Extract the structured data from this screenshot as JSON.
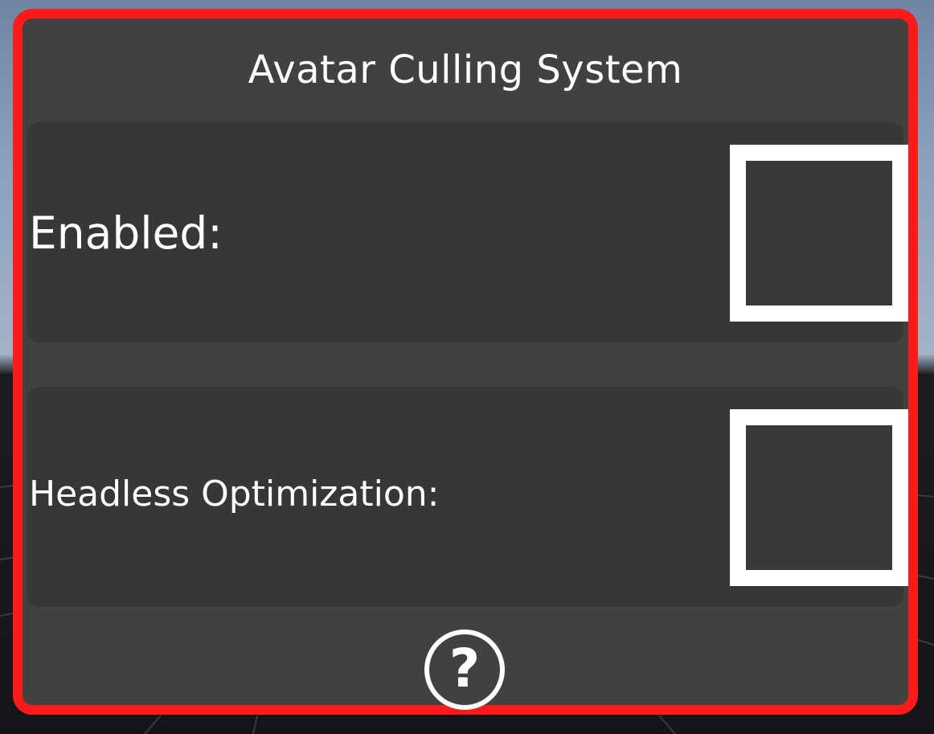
{
  "panel": {
    "title": "Avatar Culling System",
    "accent_color": "#ff1a1a",
    "background_color": "#414141"
  },
  "settings": [
    {
      "label": "Enabled:",
      "checked": false
    },
    {
      "label": "Headless Optimization:",
      "checked": false
    }
  ],
  "help": {
    "icon": "question-mark-circle-icon",
    "glyph": "?"
  }
}
